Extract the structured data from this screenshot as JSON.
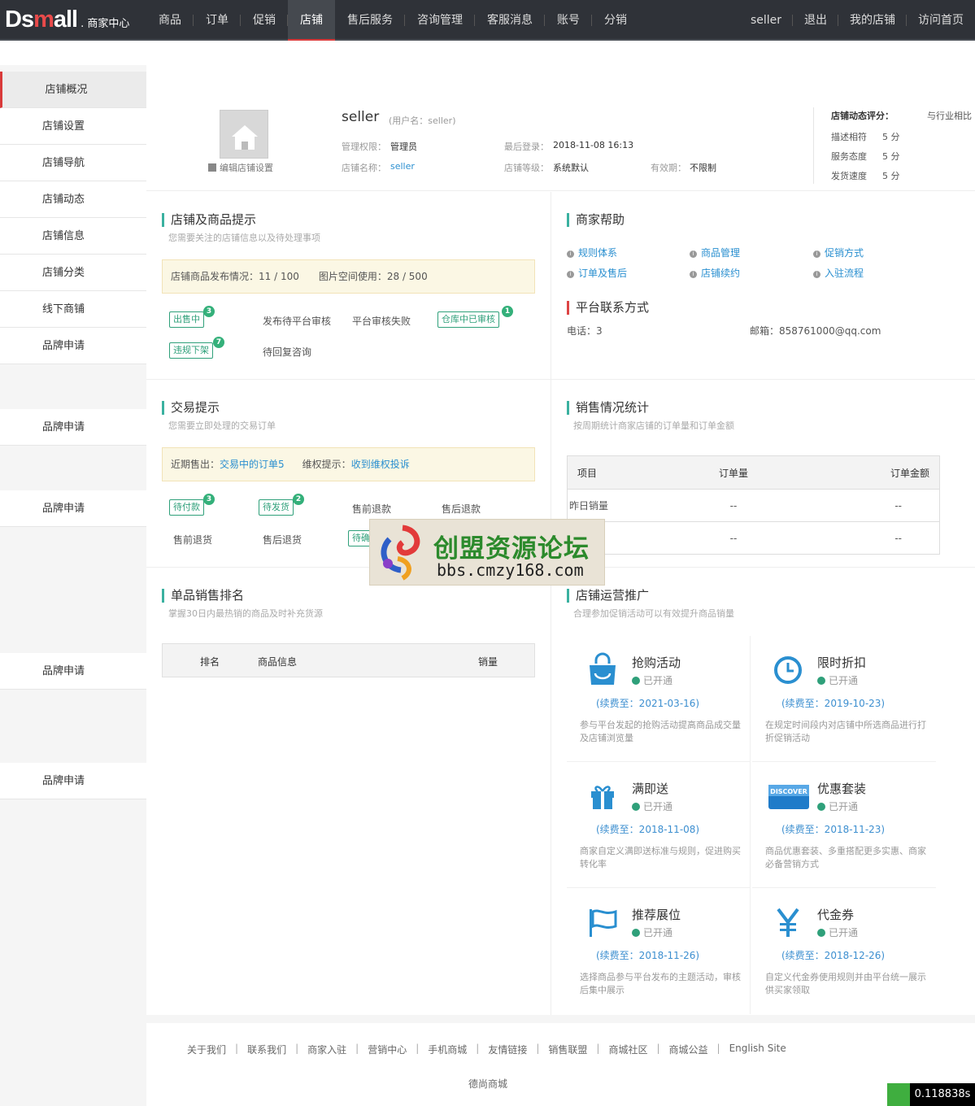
{
  "header": {
    "logo_main": "Ds",
    "logo_red": "m",
    "logo_rest": "all",
    "logo_sub": ". 商家中心",
    "nav": [
      "商品",
      "订单",
      "促销",
      "店铺",
      "售后服务",
      "咨询管理",
      "客服消息",
      "账号",
      "分销"
    ],
    "active_nav": "店铺",
    "right": [
      "seller",
      "退出",
      "我的店铺",
      "访问首页"
    ]
  },
  "sidebar": {
    "items": [
      "店铺概况",
      "店铺设置",
      "店铺导航",
      "店铺动态",
      "店铺信息",
      "店铺分类",
      "线下商铺",
      "品牌申请",
      "品牌申请",
      "品牌申请",
      "品牌申请",
      "品牌申请"
    ]
  },
  "profile": {
    "edit_link": "编辑店铺设置",
    "name": "seller",
    "username": "(用户名：seller)",
    "perm_label": "管理权限：",
    "perm_value": "管理员",
    "login_label": "最后登录：",
    "login_value": "2018-11-08 16:13",
    "store_label": "店铺名称：",
    "store_value": "seller",
    "level_label": "店铺等级：",
    "level_value": "系统默认",
    "valid_label": "有效期：",
    "valid_value": "不限制"
  },
  "rating": {
    "title": "店铺动态评分：",
    "compare": "与行业相比",
    "rows": [
      {
        "label": "描述相符",
        "value": "5 分"
      },
      {
        "label": "服务态度",
        "value": "5 分"
      },
      {
        "label": "发货速度",
        "value": "5 分"
      }
    ]
  },
  "store_tips": {
    "title": "店铺及商品提示",
    "subtitle": "您需要关注的店铺信息以及待处理事项",
    "notice_a": "店铺商品发布情况：11 /  100",
    "notice_b": "图片空间使用：28 / 500",
    "tag1": "出售中",
    "badge1": "3",
    "item2": "发布待平台审核",
    "item3": "平台审核失败",
    "tag4": "仓库中已审核",
    "badge4": "1",
    "tag5": "违规下架",
    "badge5": "7",
    "item6": "待回复咨询"
  },
  "help": {
    "title": "商家帮助",
    "links": [
      "规则体系",
      "商品管理",
      "促销方式",
      "订单及售后",
      "店铺续约",
      "入驻流程"
    ],
    "contact_title": "平台联系方式",
    "phone": "电话：3",
    "email": "邮箱：858761000@qq.com"
  },
  "trade_tips": {
    "title": "交易提示",
    "subtitle": "您需要立即处理的交易订单",
    "notice_prefix": "近期售出：",
    "notice_link1": "交易中的订单",
    "notice_count": "5",
    "notice_mid": "维权提示：",
    "notice_link2": "收到维权投诉",
    "tag1": "待付款",
    "badge1": "3",
    "tag2": "待发货",
    "badge2": "2",
    "item3": "售前退款",
    "item4": "售后退款",
    "item5": "售前退货",
    "item6": "售后退货",
    "tag7": "待确"
  },
  "sales": {
    "title": "销售情况统计",
    "subtitle": "按周期统计商家店铺的订单量和订单金额",
    "headers": [
      "项目",
      "订单量",
      "订单金额"
    ],
    "rows": [
      [
        "昨日销量",
        "--",
        "--"
      ],
      [
        "",
        "--",
        "--"
      ]
    ]
  },
  "ranking": {
    "title": "单品销售排名",
    "subtitle": "掌握30日内最热销的商品及时补充货源",
    "headers": [
      "排名",
      "商品信息",
      "销量"
    ]
  },
  "promotion": {
    "title": "店铺运营推广",
    "subtitle": "合理参加促销活动可以有效提升商品销量",
    "items": [
      {
        "name": "抢购活动",
        "status": "已开通",
        "expire": "(续费至：2021-03-16)",
        "desc": "参与平台发起的抢购活动提高商品成交量及店铺浏览量",
        "icon": "shopping-bag-icon"
      },
      {
        "name": "限时折扣",
        "status": "已开通",
        "expire": "(续费至：2019-10-23)",
        "desc": "在规定时间段内对店铺中所选商品进行打折促销活动",
        "icon": "clock-icon"
      },
      {
        "name": "满即送",
        "status": "已开通",
        "expire": "(续费至：2018-11-08)",
        "desc": "商家自定义满即送标准与规则，促进购买转化率",
        "icon": "gift-icon"
      },
      {
        "name": "优惠套装",
        "status": "已开通",
        "expire": "(续费至：2018-11-23)",
        "desc": "商品优惠套装、多重搭配更多实惠、商家必备营销方式",
        "icon": "discover-card-icon"
      },
      {
        "name": "推荐展位",
        "status": "已开通",
        "expire": "(续费至：2018-11-26)",
        "desc": "选择商品参与平台发布的主题活动，审核后集中展示",
        "icon": "flag-icon"
      },
      {
        "name": "代金券",
        "status": "已开通",
        "expire": "(续费至：2018-12-26)",
        "desc": "自定义代金券使用规则并由平台统一展示供买家领取",
        "icon": "yen-icon"
      }
    ]
  },
  "footer": {
    "links": [
      "关于我们",
      "联系我们",
      "商家入驻",
      "营销中心",
      "手机商城",
      "友情链接",
      "销售联盟",
      "商城社区",
      "商城公益",
      "English Site"
    ],
    "copyright": "德尚商城"
  },
  "watermark": {
    "cn": "创盟资源论坛",
    "url": "bbs.cmzy168.com"
  },
  "timer": "0.118838s",
  "colors": {
    "accent": "#3ab1a0",
    "active_red": "#d93a3a",
    "link": "#2a8fd0",
    "topbar": "#2f3238"
  }
}
